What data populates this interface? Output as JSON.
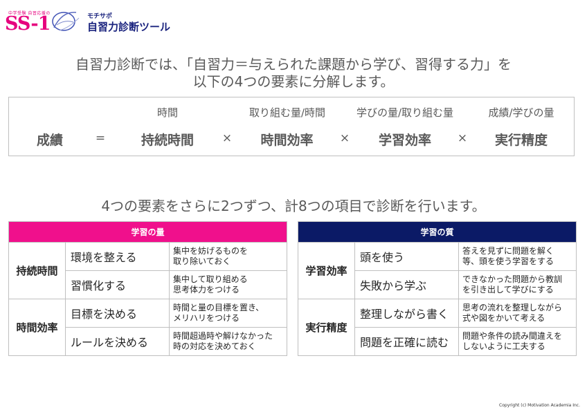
{
  "header": {
    "brand_small": "中学受験 自習応援の",
    "brand_logo": "SS-1",
    "tool_sub": "モチサポ",
    "tool_title": "自習力診断ツール"
  },
  "intro": {
    "line1": "自習力診断では、「自習力＝与えられた課題から学び、習得する力」を",
    "line2": "以下の4つの要素に分解します。"
  },
  "formula": {
    "top_labels": [
      "時間",
      "取り組む量/時間",
      "学びの量/取り組む量",
      "成績/学びの量"
    ],
    "result": "成績",
    "equals": "=",
    "factors": [
      "持続時間",
      "時間効率",
      "学習効率",
      "実行精度"
    ],
    "times": "×"
  },
  "sub_intro": "4つの要素をさらに2つずつ、計8つの項目で診断を行います。",
  "tables": {
    "left": {
      "header": "学習の量",
      "groups": [
        {
          "category": "持続時間",
          "rows": [
            {
              "item": "環境を整える",
              "desc": "集中を妨げるものを\n取り除いておく"
            },
            {
              "item": "習慣化する",
              "desc": "集中して取り組める\n思考体力をつける"
            }
          ]
        },
        {
          "category": "時間効率",
          "rows": [
            {
              "item": "目標を決める",
              "desc": "時間と量の目標を置き、\nメリハリをつける"
            },
            {
              "item": "ルールを決める",
              "desc": "時間超過時や解けなかった\n時の対応を決めておく"
            }
          ]
        }
      ]
    },
    "right": {
      "header": "学習の質",
      "groups": [
        {
          "category": "学習効率",
          "rows": [
            {
              "item": "頭を使う",
              "desc": "答えを見ずに問題を解く\n等、頭を使う学習をする"
            },
            {
              "item": "失敗から学ぶ",
              "desc": "できなかった問題から教訓\nを引き出して学びにする"
            }
          ]
        },
        {
          "category": "実行精度",
          "rows": [
            {
              "item": "整理しながら書く",
              "desc": "思考の流れを整理しながら\n式や図をかいて考える"
            },
            {
              "item": "問題を正確に読む",
              "desc": "問題や条件の読み間違えを\nしないように工夫する"
            }
          ]
        }
      ]
    }
  },
  "footer": {
    "copyright": "Copyright (c) Motivation Academia Inc."
  },
  "colors": {
    "brand_pink": "#e6007e",
    "quantity_header": "#f0108c",
    "quality_header": "#0b1a66",
    "tool_title": "#1a237e"
  }
}
